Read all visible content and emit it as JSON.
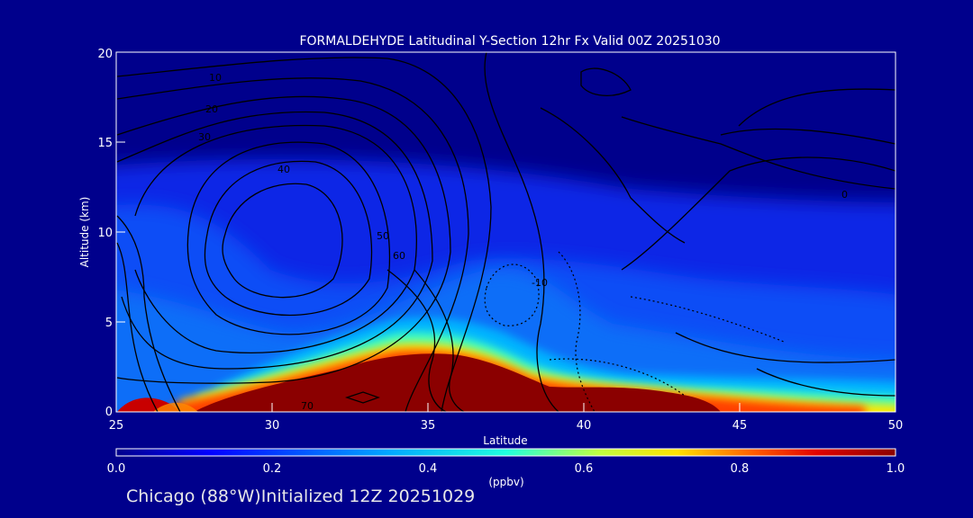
{
  "chart_data": {
    "type": "heatmap",
    "title": "FORMALDEHYDE Latitudinal Y-Section 12hr  Fx Valid 00Z 20251030",
    "xlabel": "Latitude",
    "ylabel": "Altitude (km)",
    "xlim": [
      25,
      50
    ],
    "ylim": [
      0,
      20
    ],
    "xticks": [
      "25",
      "30",
      "35",
      "40",
      "45",
      "50"
    ],
    "yticks": [
      "0",
      "5",
      "10",
      "15",
      "20"
    ],
    "colorbar": {
      "label": "(ppbv)",
      "range": [
        0.0,
        1.0
      ],
      "ticks": [
        "0.0",
        "0.2",
        "0.4",
        "0.6",
        "0.8",
        "1.0"
      ]
    },
    "surface_top_km": [
      [
        25,
        0.5
      ],
      [
        27,
        0.8
      ],
      [
        28,
        1.3
      ],
      [
        30,
        1.9
      ],
      [
        32,
        2.5
      ],
      [
        34,
        3.0
      ],
      [
        35,
        3.1
      ],
      [
        36,
        2.8
      ],
      [
        37,
        2.1
      ],
      [
        38,
        1.4
      ],
      [
        39,
        1.0
      ],
      [
        40,
        1.1
      ],
      [
        41,
        1.2
      ],
      [
        42,
        1.0
      ],
      [
        43,
        0.8
      ],
      [
        44,
        0.5
      ],
      [
        45,
        0.4
      ],
      [
        47,
        0.3
      ],
      [
        50,
        0.2
      ]
    ],
    "contour_labels": [
      "10",
      "20",
      "30",
      "40",
      "50",
      "60",
      "70",
      "-10",
      "0"
    ],
    "colors": {
      "background": "#00008c",
      "axis": "#ffffff",
      "contour": "#000000"
    }
  },
  "footer": {
    "text": "Chicago (88°W)Initialized 12Z 20251029"
  }
}
